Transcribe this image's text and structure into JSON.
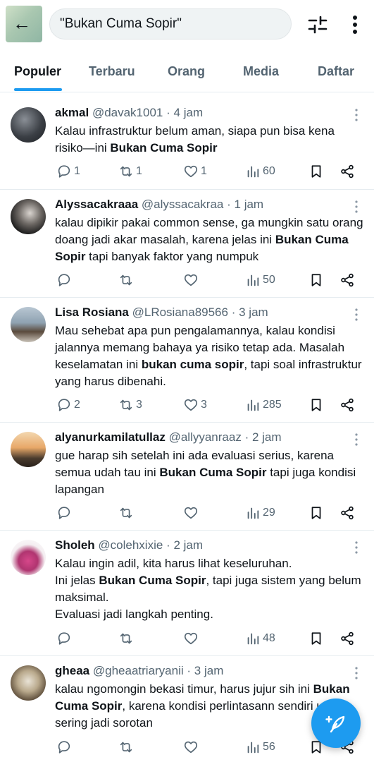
{
  "search": {
    "query": "\"Bukan Cuma Sopir\""
  },
  "tabs": [
    {
      "label": "Populer",
      "active": true
    },
    {
      "label": "Terbaru"
    },
    {
      "label": "Orang"
    },
    {
      "label": "Media"
    },
    {
      "label": "Daftar"
    }
  ],
  "colors": {
    "accent": "#1d9bf0",
    "text": "#0f1419",
    "secondary": "#536471"
  },
  "tweets": [
    {
      "name": "akmal",
      "handle": "@davak1001",
      "sep": "·",
      "time": "4 jam",
      "paragraphs": [
        [
          {
            "t": "Kalau infrastruktur belum aman, siapa pun bisa kena risiko—ini "
          },
          {
            "t": "Bukan Cuma Sopir",
            "b": true
          }
        ]
      ],
      "replies": "1",
      "reposts": "1",
      "likes": "1",
      "views": "60"
    },
    {
      "name": "Alyssacakraaa",
      "handle": "@alyssacakraa",
      "sep": "·",
      "time": "1 jam",
      "paragraphs": [
        [
          {
            "t": "kalau dipikir pakai common sense, ga mungkin satu orang doang jadi akar masalah, karena jelas ini "
          },
          {
            "t": "Bukan Cuma Sopir",
            "b": true
          },
          {
            "t": " tapi banyak faktor yang numpuk"
          }
        ]
      ],
      "replies": "",
      "reposts": "",
      "likes": "",
      "views": "50"
    },
    {
      "name": "Lisa Rosiana",
      "handle": "@LRosiana89566",
      "sep": "·",
      "time": "3 jam",
      "paragraphs": [
        [
          {
            "t": "Mau sehebat apa pun pengalamannya, kalau kondisi jalannya memang bahaya ya risiko tetap ada. Masalah keselamatan ini "
          },
          {
            "t": "bukan cuma sopir",
            "b": true
          },
          {
            "t": ", tapi soal infrastruktur yang harus dibenahi."
          }
        ]
      ],
      "replies": "2",
      "reposts": "3",
      "likes": "3",
      "views": "285"
    },
    {
      "name": "alyanurkamilatullaz",
      "handle": "@allyyanraaz",
      "sep": "·",
      "time": "2 jam",
      "paragraphs": [
        [
          {
            "t": "gue harap sih setelah ini ada evaluasi serius, karena semua udah tau ini "
          },
          {
            "t": "Bukan Cuma Sopir",
            "b": true
          },
          {
            "t": " tapi juga kondisi lapangan"
          }
        ]
      ],
      "replies": "",
      "reposts": "",
      "likes": "",
      "views": "29"
    },
    {
      "name": "Sholeh",
      "handle": "@colehxixie",
      "sep": "·",
      "time": "2 jam",
      "paragraphs": [
        [
          {
            "t": "Kalau ingin adil, kita harus lihat keseluruhan."
          }
        ],
        [
          {
            "t": "Ini jelas "
          },
          {
            "t": "Bukan Cuma Sopir",
            "b": true
          },
          {
            "t": ", tapi juga sistem yang belum maksimal."
          }
        ],
        [
          {
            "t": "Evaluasi jadi langkah penting."
          }
        ]
      ],
      "replies": "",
      "reposts": "",
      "likes": "",
      "views": "48"
    },
    {
      "name": "gheaa",
      "handle": "@gheaatriaryanii",
      "sep": "·",
      "time": "3 jam",
      "paragraphs": [
        [
          {
            "t": "kalau ngomongin bekasi timur, harus jujur sih ini "
          },
          {
            "t": "Bukan Cuma Sopir",
            "b": true
          },
          {
            "t": ", karena kondisi perlintasann sendiri udah sering jadi sorotan"
          }
        ]
      ],
      "replies": "",
      "reposts": "",
      "likes": "",
      "views": "56"
    }
  ]
}
